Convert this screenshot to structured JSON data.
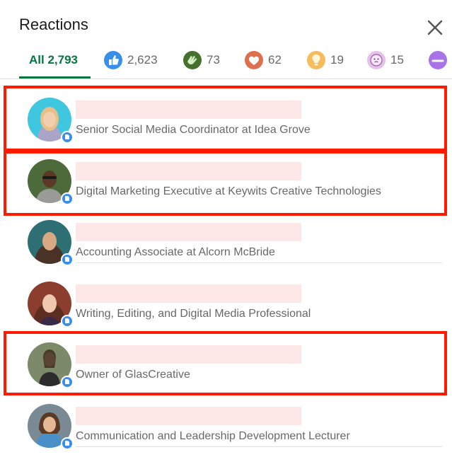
{
  "dialog": {
    "title": "Reactions"
  },
  "tabs": [
    {
      "label": "All 2,793",
      "icon": "all"
    },
    {
      "count": "2,623",
      "icon": "like-icon"
    },
    {
      "count": "73",
      "icon": "celebrate-icon"
    },
    {
      "count": "62",
      "icon": "love-icon"
    },
    {
      "count": "19",
      "icon": "insightful-icon"
    },
    {
      "count": "15",
      "icon": "curious-icon"
    },
    {
      "count": "",
      "icon": "support-icon"
    }
  ],
  "people": [
    {
      "headline": "Senior Social Media Coordinator at Idea Grove"
    },
    {
      "headline": "Digital Marketing Executive at Keywits Creative Technologies"
    },
    {
      "headline": "Accounting Associate at Alcorn McBride"
    },
    {
      "headline": "Writing, Editing, and Digital Media Professional"
    },
    {
      "headline": "Owner of GlasCreative"
    },
    {
      "headline": "Communication and Leadership Development Lecturer"
    }
  ],
  "colors": {
    "active_tab": "#057642",
    "highlight_box": "#ff1a00",
    "name_redaction": "#fde7e7",
    "like_badge": "#378fe9"
  }
}
